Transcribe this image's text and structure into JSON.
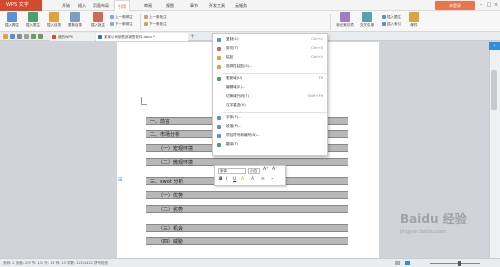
{
  "app": {
    "name": "WPS 文字",
    "unlogin": "未登录"
  },
  "menu": [
    "开始",
    "插入",
    "页面布局",
    "引用",
    "审阅",
    "视图",
    "章节",
    "开发工具",
    "云服务"
  ],
  "ribbon": {
    "big_buttons": [
      "插入脚注",
      "插入尾注",
      "插入目录",
      "更新目录",
      "插入批注"
    ],
    "small_left": [
      "上一条脚注",
      "下一条脚注"
    ],
    "small_right": [
      "上一条批注",
      "下一条批注"
    ],
    "other": [
      "标记索引项",
      "交叉引用",
      "插入题注",
      "插入索引",
      "邮件"
    ]
  },
  "tabs": [
    {
      "label": "我的WPS"
    },
    {
      "label": "某某公司销售部销售软件.docx *"
    }
  ],
  "context_menu": {
    "items": [
      {
        "label": "复制(C)",
        "shortcut": "Ctrl+C"
      },
      {
        "label": "剪切(T)",
        "shortcut": "Ctrl+X"
      },
      {
        "label": "粘贴",
        "shortcut": "Ctrl+V"
      },
      {
        "label": "选择性粘贴(S)...",
        "shortcut": ""
      },
      {
        "label": "更新域(U)",
        "shortcut": "F9"
      },
      {
        "label": "编辑域(E)...",
        "shortcut": ""
      },
      {
        "label": "切换域代码(T)",
        "shortcut": "Shift+F9"
      },
      {
        "label": "汉字重选(V)",
        "shortcut": ""
      },
      {
        "label": "字体(F)...",
        "shortcut": ""
      },
      {
        "label": "段落(P)...",
        "shortcut": ""
      },
      {
        "label": "项目符号和编号(N)...",
        "shortcut": ""
      },
      {
        "label": "翻译(T)",
        "shortcut": ""
      }
    ]
  },
  "mini_toolbar": {
    "font": "宋体",
    "size": "小四",
    "buttons": [
      "B",
      "I",
      "U",
      "A",
      "A"
    ]
  },
  "document": {
    "headings": [
      "一、前言",
      "二、市场分析",
      "（一）宏观环境",
      "（二）微观环境",
      "三、swot 分析",
      "（一）优势",
      "（二）劣势",
      "（三）机会",
      "（四）威胁"
    ]
  },
  "status": {
    "text": "页码: 2  页面: 2/9  节: 1/1  行: 15  列: 15  字数: 122/4421  拼写检查"
  },
  "watermark": {
    "title": "Baidu 经验",
    "sub": "jingyan.baidu.com"
  },
  "colors": {
    "app": "#d24a2f",
    "accent_blue": "#2f8fdb",
    "unlogin": "#e9754f"
  }
}
